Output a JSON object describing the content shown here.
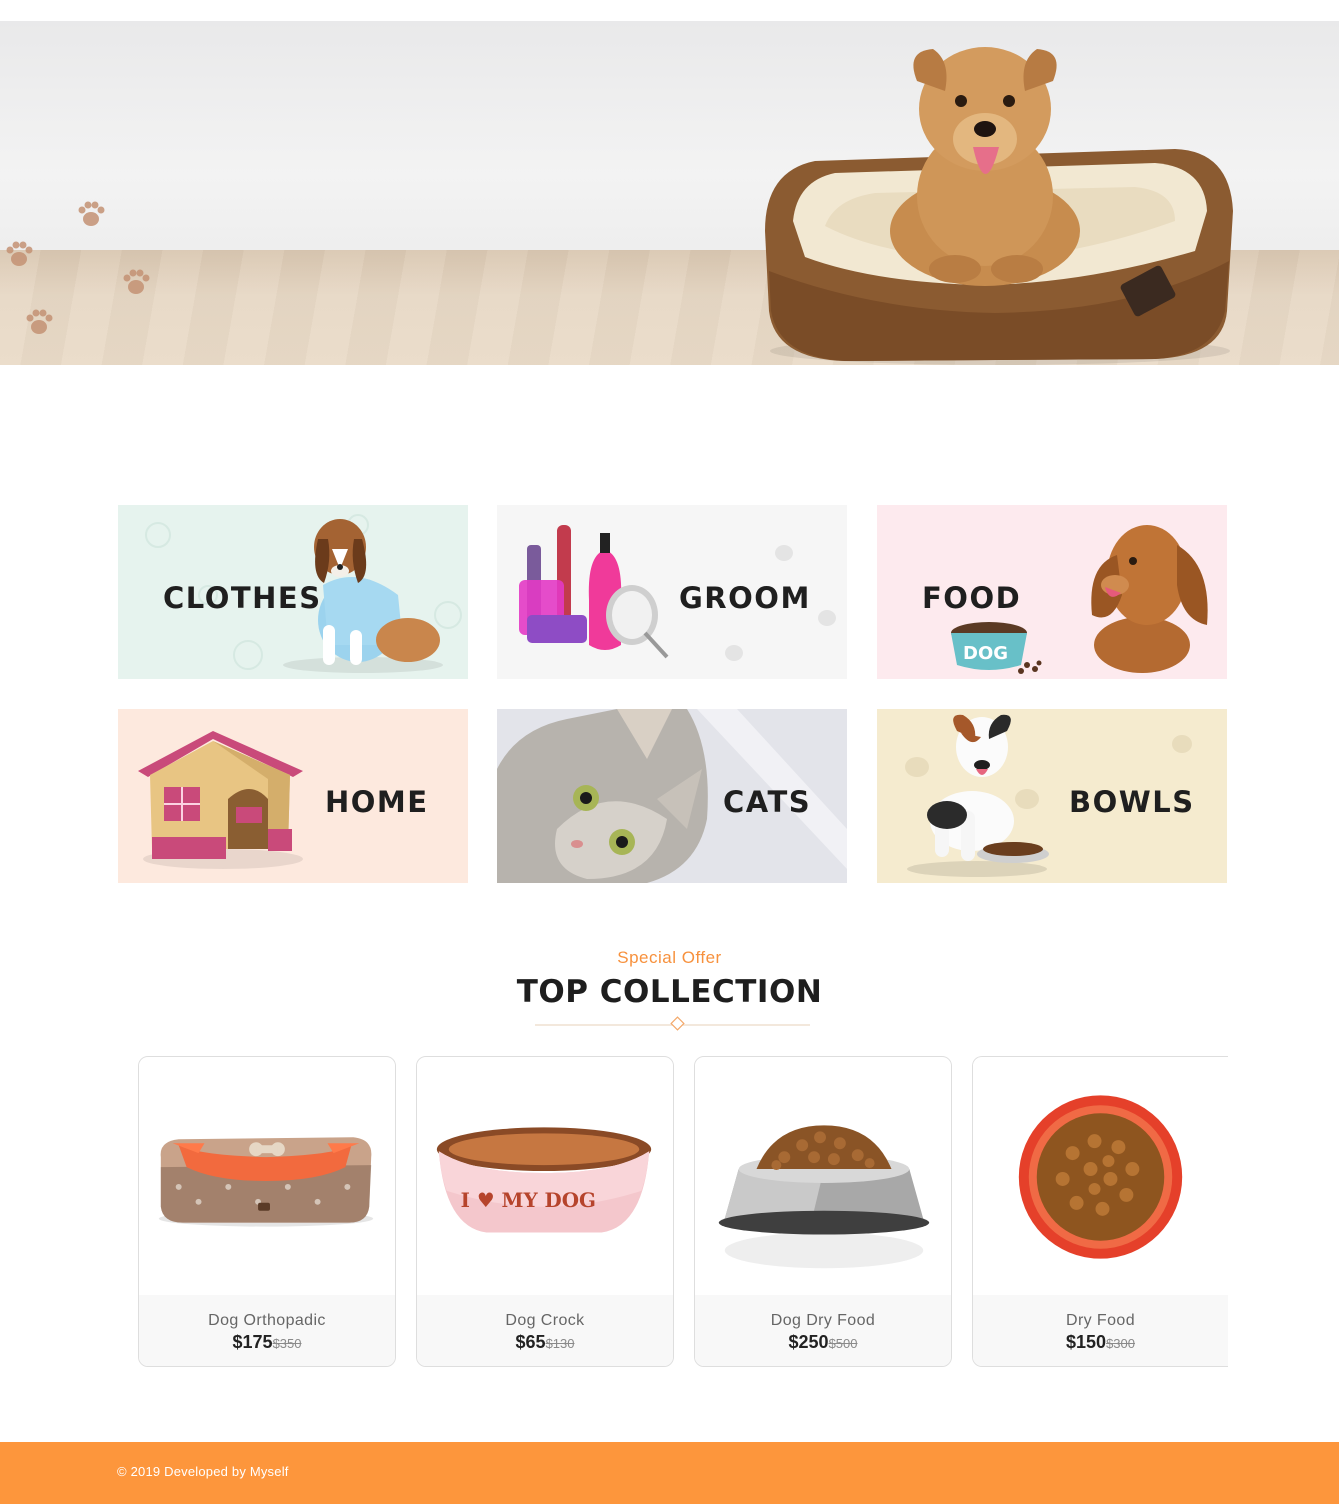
{
  "hero": {
    "colors": {
      "sky": "#eeeeef",
      "floor": "#e5d5c1",
      "bed": "#8a5a30",
      "dog": "#c98f52"
    }
  },
  "categories": [
    {
      "label": "CLOTHES",
      "bg": "#e6f3ee",
      "icon": "dog-in-shirt-image"
    },
    {
      "label": "GROOM",
      "bg": "#f6f6f6",
      "icon": "grooming-kit-image"
    },
    {
      "label": "FOOD",
      "bg": "#fdeaee",
      "icon": "dog-food-image"
    },
    {
      "label": "HOME",
      "bg": "#fde9de",
      "icon": "dog-house-image"
    },
    {
      "label": "CATS",
      "bg": "#e3e4ea",
      "icon": "cat-image"
    },
    {
      "label": "BOWLS",
      "bg": "#f5ebcf",
      "icon": "dog-with-bowl-image"
    }
  ],
  "section": {
    "subtitle": "Special Offer",
    "title": "TOP COLLECTION",
    "accent": "#f7913d"
  },
  "products": [
    {
      "name": "Dog Orthopadic",
      "price": "$175",
      "old_price": "$350",
      "icon": "pet-bed-image"
    },
    {
      "name": "Dog Crock",
      "price": "$65",
      "old_price": "$130",
      "icon": "pink-bowl-image",
      "bowl_text": "I ♥ MY DOG"
    },
    {
      "name": "Dog Dry Food",
      "price": "$250",
      "old_price": "$500",
      "icon": "steel-bowl-image"
    },
    {
      "name": "Dry Food",
      "price": "$150",
      "old_price": "$300",
      "icon": "red-bowl-image"
    }
  ],
  "footer": {
    "copyright": "© 2019 Developed by Myself",
    "bg": "#fd963c"
  }
}
